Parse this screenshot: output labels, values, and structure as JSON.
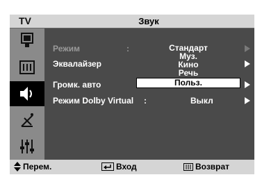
{
  "header": {
    "tv_label": "TV",
    "title": "Звук"
  },
  "sidebar": {
    "items": [
      {
        "icon": "picture-menu-icon"
      },
      {
        "icon": "sound-settings-icon"
      },
      {
        "icon": "speaker-icon",
        "active": true
      },
      {
        "icon": "antenna-icon"
      },
      {
        "icon": "setup-sliders-icon"
      }
    ]
  },
  "menu": {
    "mode_label": "Режим",
    "mode_colon": ":",
    "equalizer_label": "Эквалайзер",
    "auto_volume_label": "Громк. авто",
    "dolby_label": "Режим Dolby Virtual",
    "dolby_colon": ":",
    "dolby_value": "Выкл"
  },
  "mode_dropdown": {
    "options": [
      "Стандарт",
      "Муз.",
      "Кино",
      "Речь",
      "Польз."
    ],
    "selected": "Польз."
  },
  "footer": {
    "move_label": "Перем.",
    "enter_label": "Вход",
    "return_label": "Возврат"
  }
}
